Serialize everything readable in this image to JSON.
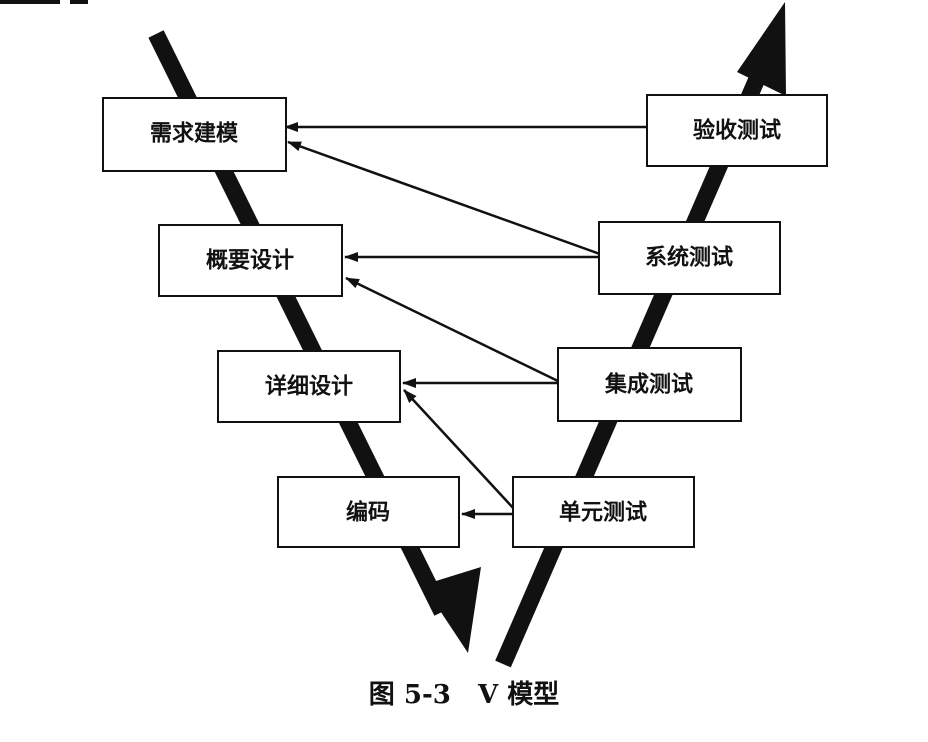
{
  "caption": "图 5-3   V 模型",
  "colors": {
    "ink": "#111111",
    "background": "#ffffff"
  },
  "boxes": {
    "requirements_modeling": "需求建模",
    "high_level_design": "概要设计",
    "detailed_design": "详细设计",
    "coding": "编码",
    "acceptance_testing": "验收测试",
    "system_testing": "系统测试",
    "integration_testing": "集成测试",
    "unit_testing": "单元测试"
  }
}
